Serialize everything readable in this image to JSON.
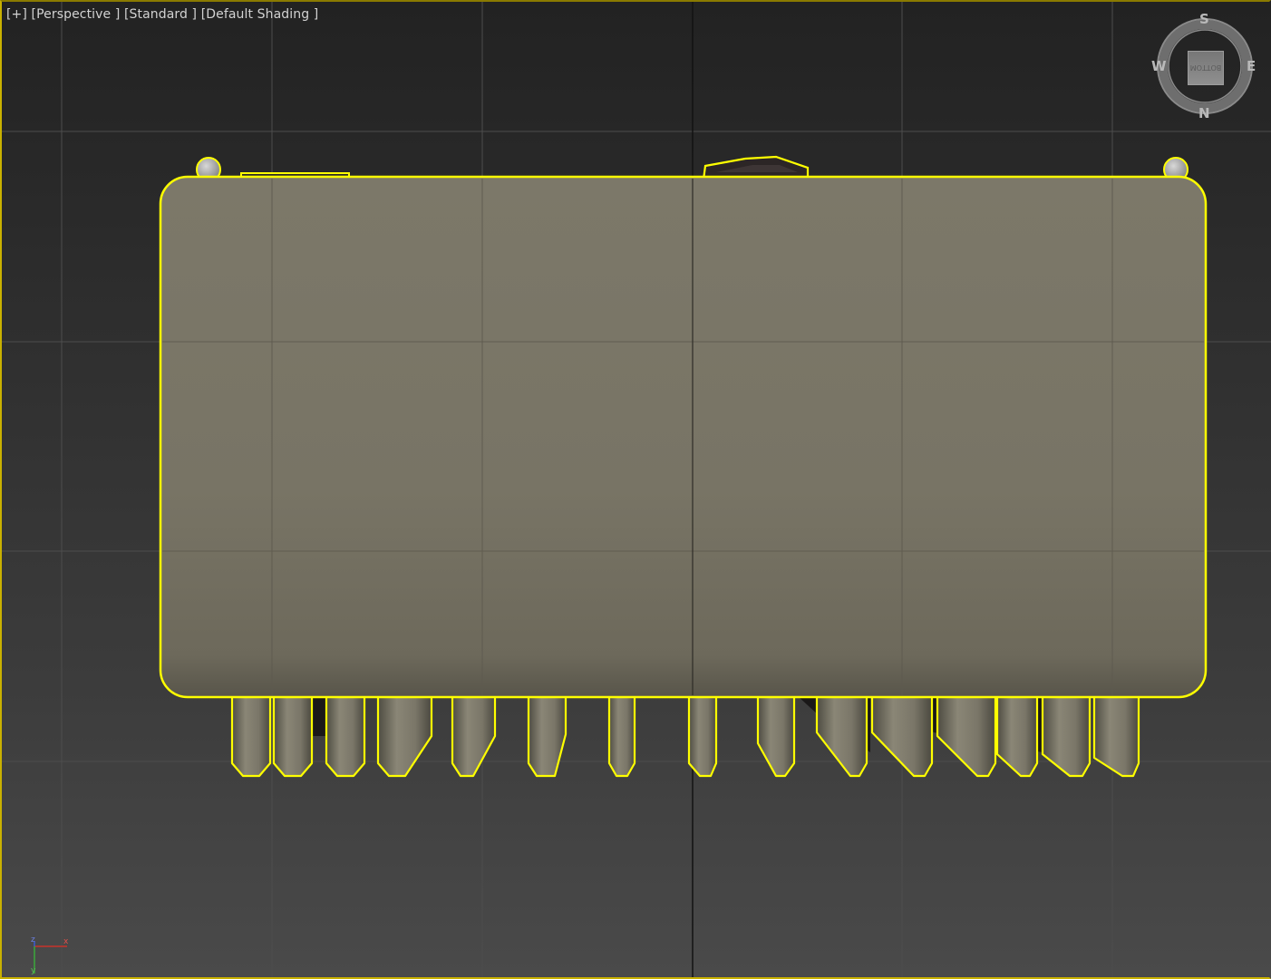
{
  "viewport": {
    "label": "[+] [Perspective ] [Standard ] [Default Shading ]",
    "labels": {
      "plus": "[+]",
      "view": "[Perspective ]",
      "mode": "[Standard ]",
      "shading": "[Default Shading ]"
    },
    "active_border_color": "#c9b100",
    "selection_color": "#ffff00",
    "object_color": "#7a7566"
  },
  "viewcube": {
    "compass": {
      "top": "S",
      "left": "W",
      "right": "E",
      "bottom": "N"
    },
    "face_label": "BOTTOM"
  },
  "axis_tripod": {
    "x": "x",
    "y": "y",
    "z": "z"
  },
  "icons": [
    "viewcube-icon",
    "compass-ring-icon",
    "axis-tripod-icon"
  ]
}
